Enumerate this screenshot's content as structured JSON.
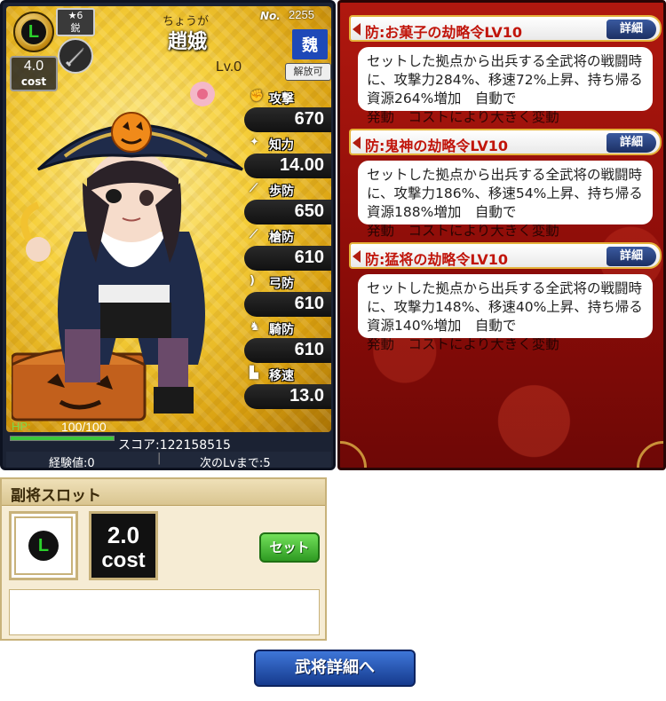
{
  "card": {
    "rarity_letter": "L",
    "star_rank": "★6",
    "rank_title": "鋭",
    "cost_value": "4.0",
    "cost_label": "cost",
    "name_reading": "ちょうが",
    "name": "趙娥",
    "number_label": "No.",
    "number": "2255",
    "faction": "魏",
    "level": "Lv.0",
    "release_label": "解放可",
    "weapon_icon": "sword-icon",
    "stats": [
      {
        "key": "attack",
        "icon": "fist-icon",
        "label": "攻撃",
        "value": "670"
      },
      {
        "key": "intelligence",
        "icon": "flame-icon",
        "label": "知力",
        "value": "14.00"
      },
      {
        "key": "infantry_def",
        "icon": "spear-icon",
        "label": "歩防",
        "value": "650"
      },
      {
        "key": "spear_def",
        "icon": "pike-icon",
        "label": "槍防",
        "value": "610"
      },
      {
        "key": "bow_def",
        "icon": "bow-icon",
        "label": "弓防",
        "value": "610"
      },
      {
        "key": "cavalry_def",
        "icon": "horse-icon",
        "label": "騎防",
        "value": "610"
      },
      {
        "key": "speed",
        "icon": "boot-icon",
        "label": "移速",
        "value": "13.0"
      }
    ],
    "hp_label": "HP:",
    "hp_value": "100/100",
    "hp_fraction": 1.0,
    "score": "スコア:122158515",
    "exp": "経験値:0",
    "next_level": "次のLvまで:5"
  },
  "skills": [
    {
      "title": "防:お菓子の劫略令LV10",
      "detail_label": "詳細",
      "description": "セットした拠点から出兵する全武将の戦闘時に、攻撃力284%、移速72%上昇、持ち帰る資源264%増加　自動で",
      "overflow": "発動　コストにより大きく変動"
    },
    {
      "title": "防:鬼神の劫略令LV10",
      "detail_label": "詳細",
      "description": "セットした拠点から出兵する全武将の戦闘時に、攻撃力186%、移速54%上昇、持ち帰る資源188%増加　自動で",
      "overflow": "発動　コストにより大きく変動"
    },
    {
      "title": "防:猛将の劫略令LV10",
      "detail_label": "詳細",
      "description": "セットした拠点から出兵する全武将の戦闘時に、攻撃力148%、移速40%上昇、持ち帰る資源140%増加　自動で",
      "overflow": "発動　コストにより大きく変動"
    }
  ],
  "sub_slot": {
    "title": "副将スロット",
    "rarity_letter": "L",
    "cost_value": "2.0",
    "cost_label": "cost",
    "set_label": "セット"
  },
  "general_detail_button": "武将詳細へ"
}
